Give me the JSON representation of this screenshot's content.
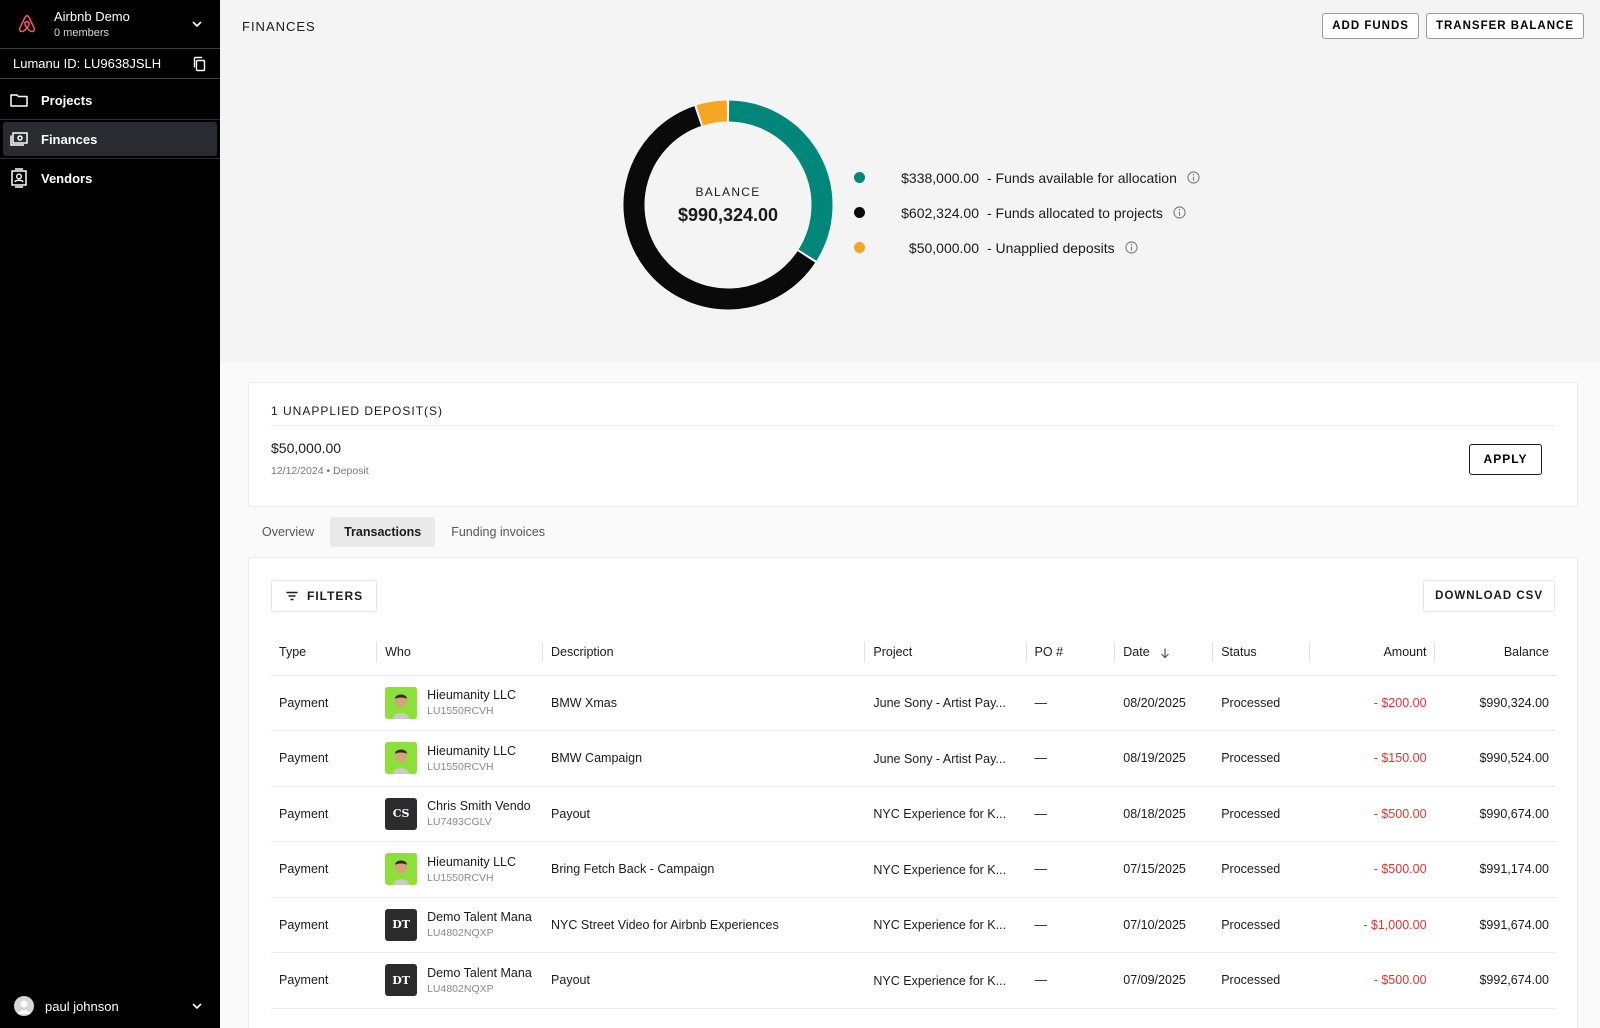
{
  "sidebar": {
    "org_name": "Airbnb Demo",
    "org_members": "0 members",
    "lumanu_id": "Lumanu ID: LU9638JSLH",
    "nav": [
      {
        "label": "Projects",
        "icon": "folder-icon"
      },
      {
        "label": "Finances",
        "icon": "cash-icon",
        "active": true
      },
      {
        "label": "Vendors",
        "icon": "contact-icon"
      }
    ],
    "user_name": "paul johnson"
  },
  "header": {
    "title": "FINANCES",
    "add_funds": "ADD FUNDS",
    "transfer_balance": "TRANSFER BALANCE"
  },
  "balance": {
    "label": "BALANCE",
    "total": "$990,324.00",
    "legend": [
      {
        "amount": "$338,000.00",
        "text": "- Funds available for allocation",
        "color": "#00877a",
        "value": 338000
      },
      {
        "amount": "$602,324.00",
        "text": "- Funds allocated to projects",
        "color": "#0a0a0a",
        "value": 602324
      },
      {
        "amount": "$50,000.00",
        "text": "- Unapplied deposits",
        "color": "#f5a623",
        "value": 50000
      }
    ]
  },
  "deposits": {
    "title": "1 UNAPPLIED DEPOSIT(S)",
    "amount": "$50,000.00",
    "meta": "12/12/2024 • Deposit",
    "apply": "APPLY"
  },
  "tabs": [
    "Overview",
    "Transactions",
    "Funding invoices"
  ],
  "active_tab": 1,
  "transactions": {
    "filters": "FILTERS",
    "download": "DOWNLOAD CSV",
    "columns": [
      "Type",
      "Who",
      "Description",
      "Project",
      "PO #",
      "Date",
      "Status",
      "Amount",
      "Balance"
    ],
    "rows": [
      {
        "type": "Payment",
        "who": "Hieumanity LLC",
        "who_id": "LU1550RCVH",
        "avatar": "photo",
        "initials": "",
        "description": "BMW Xmas",
        "project": "June Sony - Artist Pay...",
        "po": "—",
        "date": "08/20/2025",
        "status": "Processed",
        "amount": "- $200.00",
        "balance": "$990,324.00"
      },
      {
        "type": "Payment",
        "who": "Hieumanity LLC",
        "who_id": "LU1550RCVH",
        "avatar": "photo",
        "initials": "",
        "description": "BMW Campaign",
        "project": "June Sony - Artist Pay...",
        "po": "—",
        "date": "08/19/2025",
        "status": "Processed",
        "amount": "- $150.00",
        "balance": "$990,524.00"
      },
      {
        "type": "Payment",
        "who": "Chris Smith Vendo",
        "who_id": "LU7493CGLV",
        "avatar": "initials",
        "initials": "CS",
        "description": "Payout",
        "project": "NYC Experience for K...",
        "po": "—",
        "date": "08/18/2025",
        "status": "Processed",
        "amount": "- $500.00",
        "balance": "$990,674.00"
      },
      {
        "type": "Payment",
        "who": "Hieumanity LLC",
        "who_id": "LU1550RCVH",
        "avatar": "photo",
        "initials": "",
        "description": "Bring Fetch Back - Campaign",
        "project": "NYC Experience for K...",
        "po": "—",
        "date": "07/15/2025",
        "status": "Processed",
        "amount": "- $500.00",
        "balance": "$991,174.00"
      },
      {
        "type": "Payment",
        "who": "Demo Talent Mana",
        "who_id": "LU4802NQXP",
        "avatar": "initials",
        "initials": "DT",
        "description": "NYC Street Video for Airbnb Experiences",
        "project": "NYC Experience for K...",
        "po": "—",
        "date": "07/10/2025",
        "status": "Processed",
        "amount": "- $1,000.00",
        "balance": "$991,674.00"
      },
      {
        "type": "Payment",
        "who": "Demo Talent Mana",
        "who_id": "LU4802NQXP",
        "avatar": "initials",
        "initials": "DT",
        "description": "Payout",
        "project": "NYC Experience for K...",
        "po": "—",
        "date": "07/09/2025",
        "status": "Processed",
        "amount": "- $500.00",
        "balance": "$992,674.00"
      }
    ]
  }
}
